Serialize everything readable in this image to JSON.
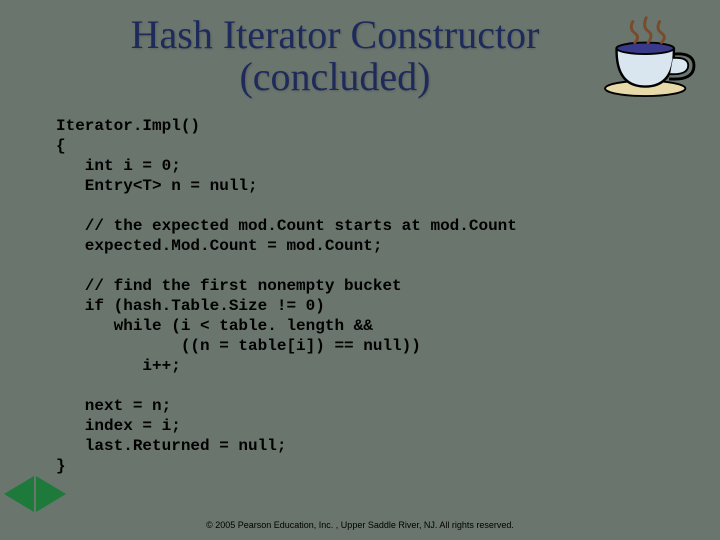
{
  "title_line1": "Hash Iterator Constructor",
  "title_line2": "(concluded)",
  "code": "Iterator.Impl()\n{\n   int i = 0;\n   Entry<T> n = null;\n\n   // the expected mod.Count starts at mod.Count\n   expected.Mod.Count = mod.Count;\n\n   // find the first nonempty bucket\n   if (hash.Table.Size != 0)\n      while (i < table. length &&\n             ((n = table[i]) == null))\n         i++;\n\n   next = n;\n   index = i;\n   last.Returned = null;\n}",
  "copyright": "© 2005 Pearson Education, Inc. , Upper Saddle River, NJ.  All rights reserved."
}
